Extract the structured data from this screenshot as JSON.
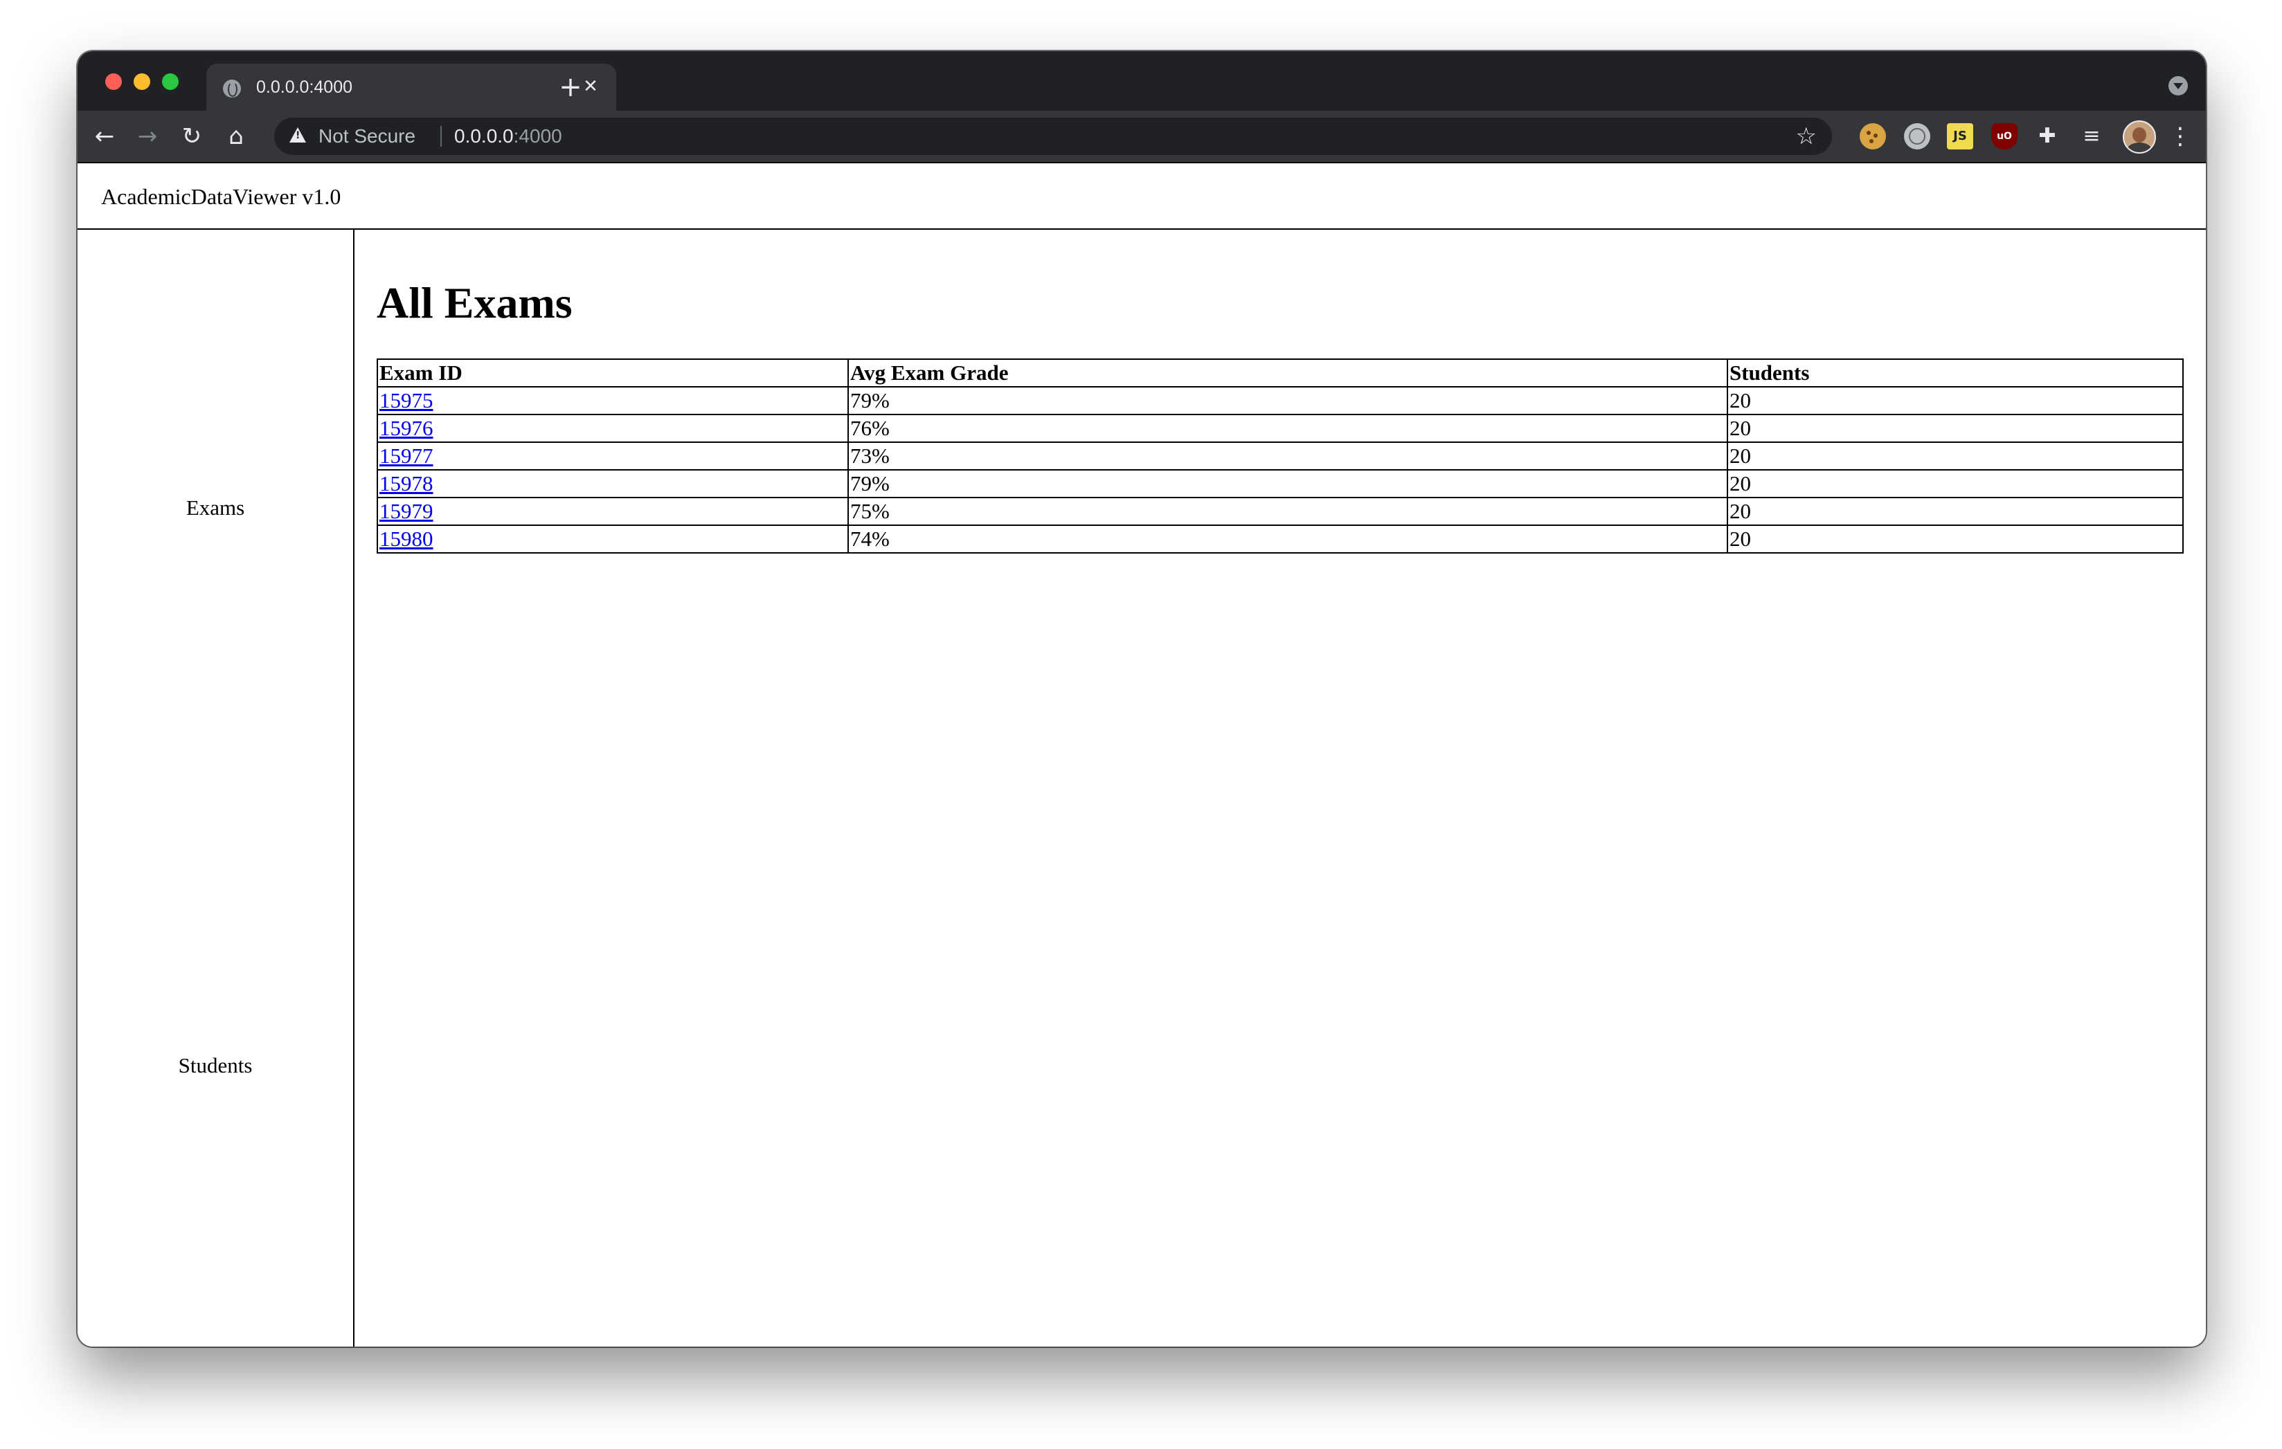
{
  "browser": {
    "tab_title": "0.0.0.0:4000",
    "security_label": "Not Secure",
    "url_host": "0.0.0.0",
    "url_port": ":4000",
    "extensions": [
      "cookie-icon",
      "globe-icon",
      "js-icon",
      "ublock-icon",
      "puzzle-icon",
      "media-control-icon"
    ]
  },
  "app": {
    "title": "AcademicDataViewer v1.0"
  },
  "sidebar": {
    "items": [
      {
        "label": "Exams"
      },
      {
        "label": "Students"
      }
    ]
  },
  "main": {
    "heading": "All Exams",
    "table": {
      "columns": [
        "Exam ID",
        "Avg Exam Grade",
        "Students"
      ],
      "rows": [
        {
          "exam_id": "15975",
          "avg_grade": "79%",
          "students": "20"
        },
        {
          "exam_id": "15976",
          "avg_grade": "76%",
          "students": "20"
        },
        {
          "exam_id": "15977",
          "avg_grade": "73%",
          "students": "20"
        },
        {
          "exam_id": "15978",
          "avg_grade": "79%",
          "students": "20"
        },
        {
          "exam_id": "15979",
          "avg_grade": "75%",
          "students": "20"
        },
        {
          "exam_id": "15980",
          "avg_grade": "74%",
          "students": "20"
        }
      ]
    }
  },
  "colors": {
    "tab_strip": "#202124",
    "toolbar": "#35363a",
    "link": "#0000ee"
  }
}
